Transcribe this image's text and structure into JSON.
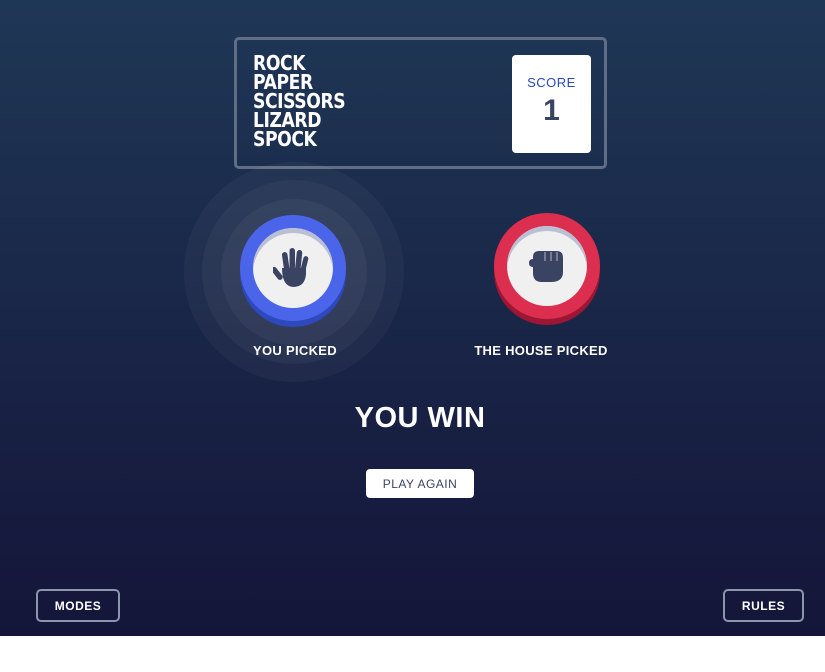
{
  "header": {
    "title_lines": [
      "ROCK",
      "PAPER",
      "SCISSORS",
      "LIZARD",
      "SPOCK"
    ],
    "score_label": "SCORE",
    "score_value": "1"
  },
  "picks": {
    "player": {
      "label": "YOU PICKED",
      "choice_icon": "paper-hand-icon",
      "color": "#4a65ea"
    },
    "house": {
      "label": "THE HOUSE PICKED",
      "choice_icon": "rock-fist-icon",
      "color": "#dc2e4e"
    }
  },
  "result": {
    "text": "YOU WIN",
    "play_again_label": "PLAY AGAIN"
  },
  "footer": {
    "modes_label": "MODES",
    "rules_label": "RULES"
  },
  "colors": {
    "background_top": "#1f3756",
    "background_bottom": "#141539",
    "icon": "#3b4363"
  }
}
